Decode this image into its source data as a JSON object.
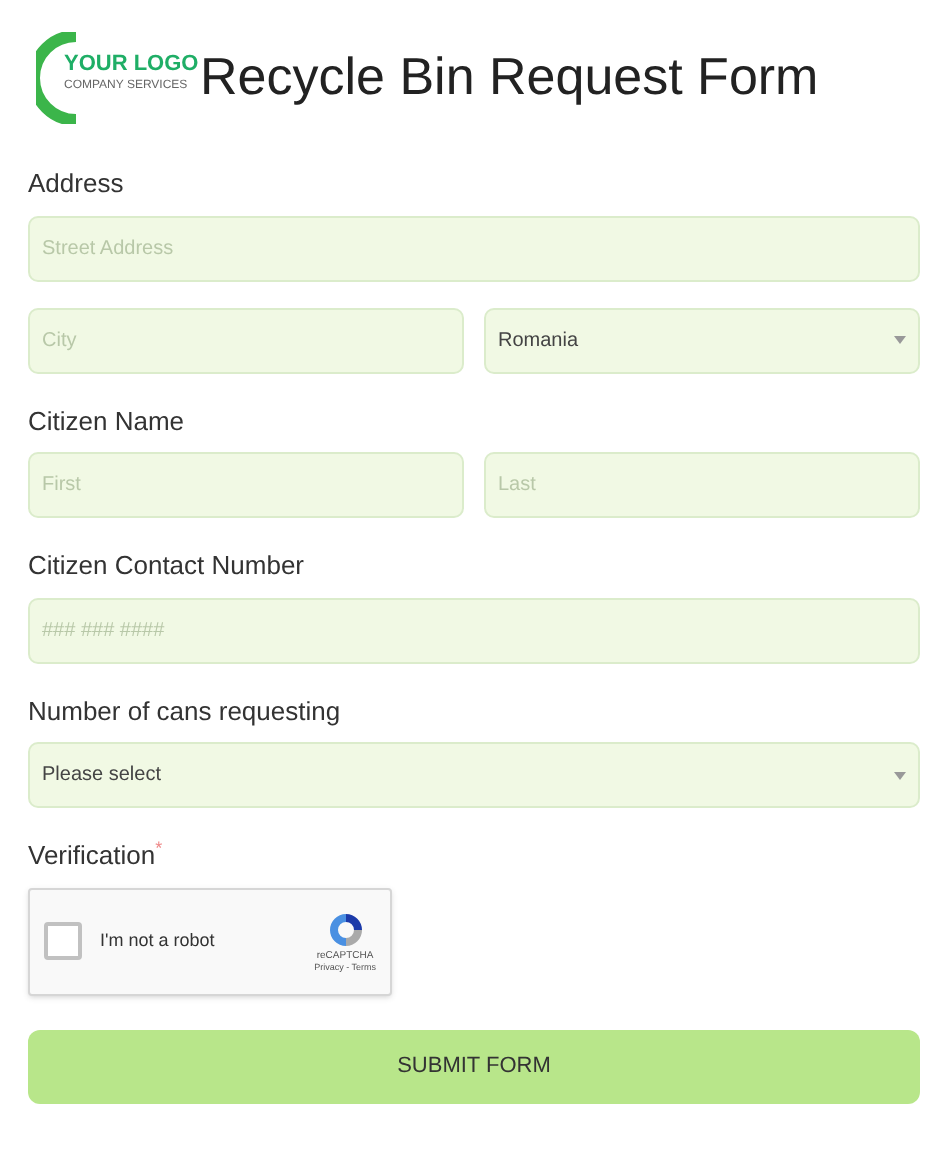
{
  "logo": {
    "text": "YOUR LOGO",
    "tagline": "COMPANY SERVICES"
  },
  "title": "Recycle Bin Request Form",
  "sections": [
    {
      "label": "Address",
      "rows": [
        [
          {
            "kind": "text",
            "placeholder": "Street Address"
          }
        ],
        [
          {
            "kind": "text",
            "placeholder": "City"
          },
          {
            "kind": "select",
            "value": "Romania"
          }
        ]
      ]
    },
    {
      "label": "Citizen Name",
      "rows": [
        [
          {
            "kind": "text",
            "placeholder": "First"
          },
          {
            "kind": "text",
            "placeholder": "Last"
          }
        ]
      ]
    },
    {
      "label": "Citizen Contact Number",
      "rows": [
        [
          {
            "kind": "text",
            "placeholder": "### ### ####"
          }
        ]
      ]
    },
    {
      "label": "Number of cans requesting",
      "rows": [
        [
          {
            "kind": "select",
            "value": "Please select"
          }
        ]
      ]
    }
  ],
  "verification": {
    "label": "Verification",
    "required_mark": "*",
    "captcha": {
      "checked": false,
      "text": "I'm not a robot",
      "brand": "reCAPTCHA",
      "links": "Privacy - Terms"
    }
  },
  "submit": "SUBMIT FORM"
}
